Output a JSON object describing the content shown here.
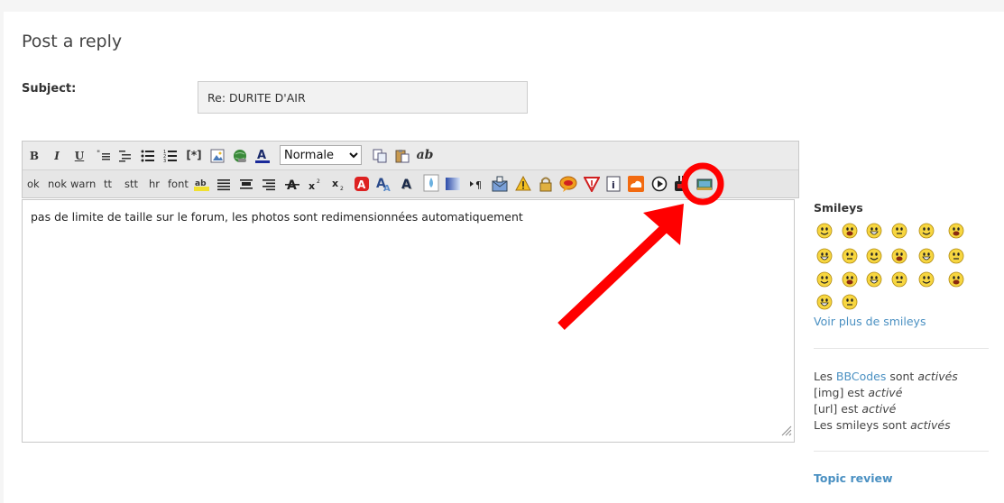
{
  "page": {
    "title": "Post a reply"
  },
  "subject": {
    "label": "Subject:",
    "value": "Re: DURITE D'AIR"
  },
  "toolbar": {
    "row1": {
      "bold": "B",
      "italic": "I",
      "underline": "U",
      "font_size": {
        "selected": "Normale",
        "options": [
          "Normale"
        ]
      },
      "abbr": "ab"
    },
    "row2_text_buttons": [
      "ok",
      "nok",
      "warn",
      "tt",
      "stt",
      "hr",
      "font"
    ],
    "icons": [
      "bold-icon",
      "italic-icon",
      "underline-icon",
      "quote-icon",
      "code-icon",
      "list-icon",
      "numbered-list-icon",
      "list-item-icon",
      "image-icon",
      "link-icon",
      "font-color-icon",
      "copy-icon",
      "paste-icon",
      "spell-icon",
      "highlight-icon",
      "align-justify-icon",
      "align-center-icon",
      "align-right-icon",
      "strike-icon",
      "superscript-icon",
      "subscript-icon",
      "flash-icon",
      "font-icon",
      "font-shadow-icon",
      "drop-icon",
      "gradient-icon",
      "paragraph-icon",
      "mail-icon",
      "warning-icon",
      "lock-icon",
      "speech-icon",
      "alert-triangle-icon",
      "info-icon",
      "soundcloud-icon",
      "play-icon",
      "youtube-icon",
      "photo-upload-icon"
    ]
  },
  "editor": {
    "content": "pas de limite de taille sur le forum, les photos sont redimensionnées automatiquement"
  },
  "sidebar": {
    "smileys_title": "Smileys",
    "smiley_count": 20,
    "more_smileys": "Voir plus de smileys",
    "bbcode": {
      "prefix": "Les ",
      "link": "BBCodes",
      "middle": " sont ",
      "status": "activés"
    },
    "img": {
      "text": "[img] est ",
      "status": "activé"
    },
    "url": {
      "text": "[url] est ",
      "status": "activé"
    },
    "smileys_status": {
      "text": "Les smileys sont ",
      "status": "activés"
    },
    "topic_review": "Topic review"
  },
  "annotation": {
    "color": "#ff0000"
  }
}
